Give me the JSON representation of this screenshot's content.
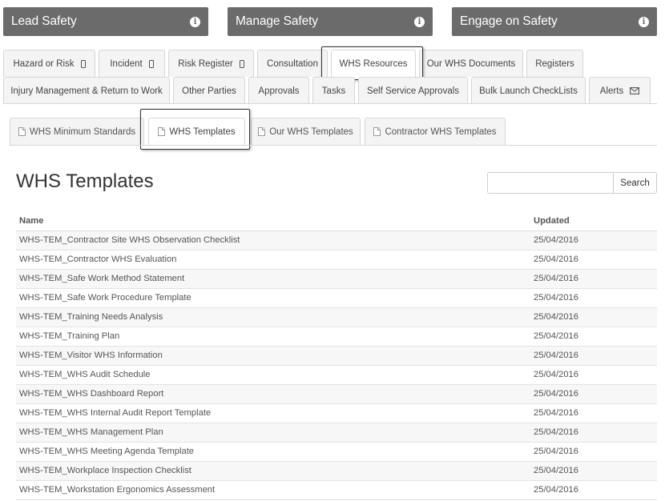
{
  "header_buttons": [
    {
      "label": "Lead Safety",
      "icon": "info-icon"
    },
    {
      "label": "Manage Safety",
      "icon": "info-icon"
    },
    {
      "label": "Engage on Safety",
      "icon": "info-icon"
    }
  ],
  "tabs_row1": [
    {
      "label": "Hazard or Risk",
      "icon": "mobile-icon"
    },
    {
      "label": "Incident",
      "icon": "mobile-icon"
    },
    {
      "label": "Risk Register",
      "icon": "mobile-icon"
    },
    {
      "label": "Consultation"
    },
    {
      "label": "WHS Resources",
      "active": true
    },
    {
      "label": "Our WHS Documents"
    },
    {
      "label": "Registers"
    }
  ],
  "tabs_row2": [
    {
      "label": "Injury Management & Return to Work"
    },
    {
      "label": "Other Parties"
    },
    {
      "label": "Approvals"
    },
    {
      "label": "Tasks"
    },
    {
      "label": "Self Service Approvals"
    },
    {
      "label": "Bulk Launch CheckLists"
    },
    {
      "label": "Alerts",
      "icon": "envelope-icon"
    }
  ],
  "subtabs": [
    {
      "label": "WHS Minimum Standards",
      "icon": "document-icon"
    },
    {
      "label": "WHS Templates",
      "icon": "document-icon",
      "active": true
    },
    {
      "label": "Our WHS Templates",
      "icon": "document-icon"
    },
    {
      "label": "Contractor WHS Templates",
      "icon": "document-icon"
    }
  ],
  "page_title": "WHS Templates",
  "search": {
    "placeholder": "",
    "button_label": "Search"
  },
  "table": {
    "columns": [
      "Name",
      "Updated"
    ],
    "rows": [
      [
        "WHS-TEM_Contractor Site WHS Observation Checklist",
        "25/04/2016"
      ],
      [
        "WHS-TEM_Contractor WHS Evaluation",
        "25/04/2016"
      ],
      [
        "WHS-TEM_Safe Work Method Statement",
        "25/04/2016"
      ],
      [
        "WHS-TEM_Safe Work Procedure Template",
        "25/04/2016"
      ],
      [
        "WHS-TEM_Training Needs Analysis",
        "25/04/2016"
      ],
      [
        "WHS-TEM_Training Plan",
        "25/04/2016"
      ],
      [
        "WHS-TEM_Visitor WHS Information",
        "25/04/2016"
      ],
      [
        "WHS-TEM_WHS Audit Schedule",
        "25/04/2016"
      ],
      [
        "WHS-TEM_WHS Dashboard Report",
        "25/04/2016"
      ],
      [
        "WHS-TEM_WHS Internal Audit Report Template",
        "25/04/2016"
      ],
      [
        "WHS-TEM_WHS Management Plan",
        "25/04/2016"
      ],
      [
        "WHS-TEM_WHS Meeting Agenda Template",
        "25/04/2016"
      ],
      [
        "WHS-TEM_Workplace Inspection Checklist",
        "25/04/2016"
      ],
      [
        "WHS-TEM_Workstation Ergonomics Assessment",
        "25/04/2016"
      ]
    ]
  },
  "colors": {
    "header_button_bg": "#6b6b6b",
    "tab_bg": "#f4f4f4",
    "active_tab_bg": "#ffffff"
  }
}
